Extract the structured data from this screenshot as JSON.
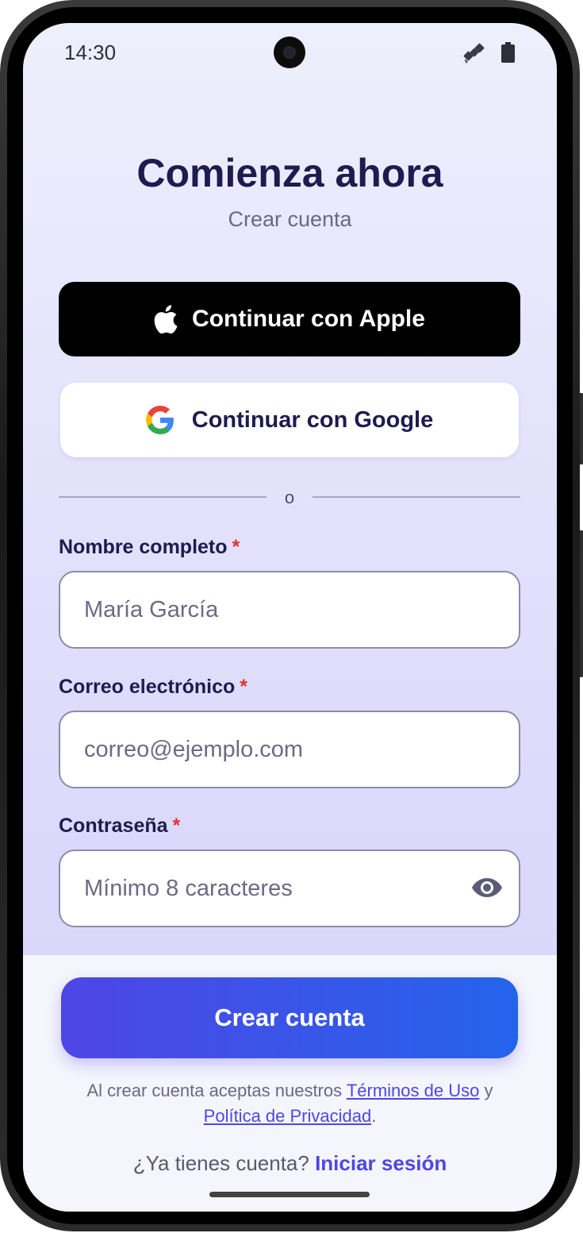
{
  "status_bar": {
    "time": "14:30",
    "icons": [
      "satellite-icon",
      "battery-icon"
    ]
  },
  "header": {
    "title": "Comienza ahora",
    "subtitle": "Crear cuenta"
  },
  "social": {
    "apple_label": "Continuar con Apple",
    "google_label": "Continuar con Google"
  },
  "divider_text": "o",
  "form": {
    "name_label": "Nombre completo",
    "name_placeholder": "María García",
    "email_label": "Correo electrónico",
    "email_placeholder": "correo@ejemplo.com",
    "password_label": "Contraseña",
    "password_placeholder": "Mínimo 8 caracteres",
    "required_mark": "*"
  },
  "actions": {
    "create_label": "Crear cuenta"
  },
  "legal": {
    "prefix": "Al crear cuenta aceptas nuestros",
    "terms_link": "Términos de Uso",
    "connector": "y",
    "privacy_link": "Política de Privacidad",
    "suffix": "."
  },
  "signin": {
    "prompt": "¿Ya tienes cuenta?",
    "link": "Iniciar sesión"
  },
  "colors": {
    "primary": "#4f46e5",
    "primary_end": "#2563eb",
    "heading": "#1d1b4f",
    "required": "#e0322f"
  }
}
